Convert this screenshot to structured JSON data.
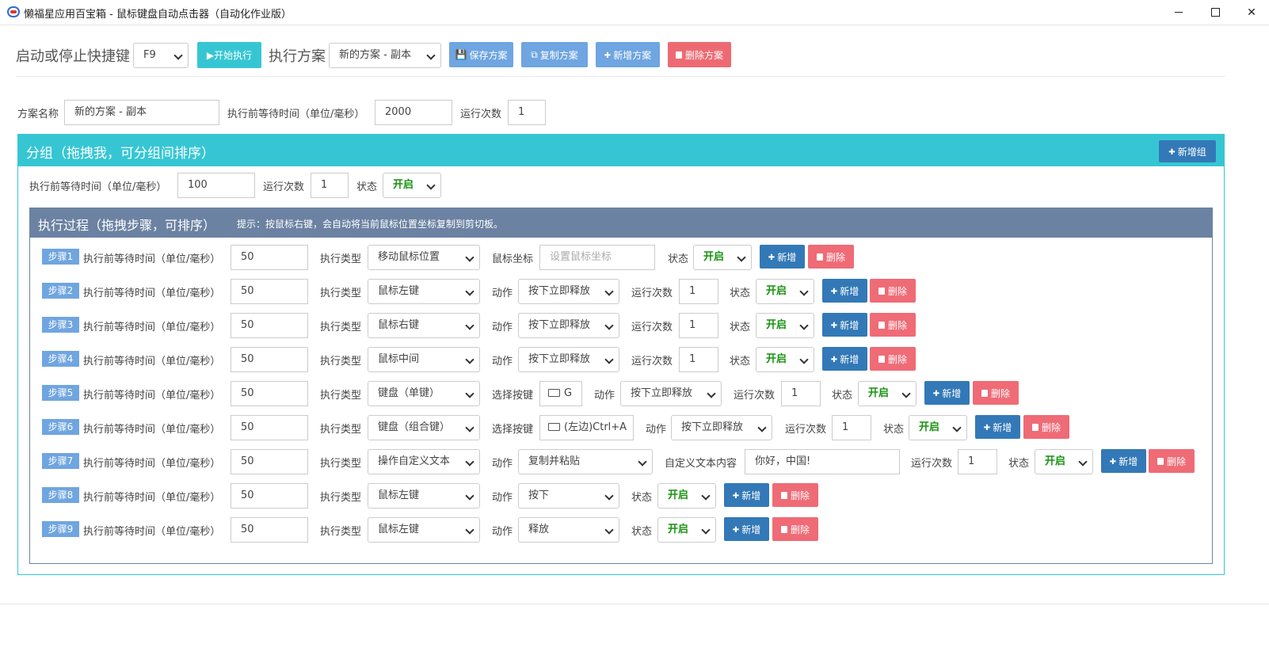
{
  "window": {
    "title": "懒福星应用百宝箱 - 鼠标键盘自动点击器（自动化作业版）"
  },
  "toolbar": {
    "hotkey_label": "启动或停止快捷键",
    "hotkey_value": "F9",
    "start_label": "▶开始执行",
    "plan_label": "执行方案",
    "plan_value": "新的方案 - 副本",
    "save_label": "保存方案",
    "copy_label": "复制方案",
    "add_label": "新增方案",
    "delete_label": "删除方案"
  },
  "plan": {
    "name_label": "方案名称",
    "name_value": "新的方案 - 副本",
    "wait_label": "执行前等待时间（单位/毫秒）",
    "wait_value": "2000",
    "runs_label": "运行次数",
    "runs_value": "1"
  },
  "group": {
    "title": "分组（拖拽我，可分组间排序）",
    "add_group_label": "新增组",
    "wait_label": "执行前等待时间（单位/毫秒）",
    "wait_value": "100",
    "runs_label": "运行次数",
    "runs_value": "1",
    "status_label": "状态",
    "status_value": "开启"
  },
  "process": {
    "title": "执行过程（拖拽步骤，可排序）",
    "hint": "提示：按鼠标右键，会自动将当前鼠标位置坐标复制到剪切板。"
  },
  "labels": {
    "wait": "执行前等待时间（单位/毫秒）",
    "type": "执行类型",
    "coord": "鼠标坐标",
    "action": "动作",
    "runs": "运行次数",
    "status": "状态",
    "key": "选择按键",
    "custom_text": "自定义文本内容",
    "add": "新增",
    "delete": "删除"
  },
  "steps": [
    {
      "badge": "步骤1",
      "wait": "50",
      "type": "移动鼠标位置",
      "coord_placeholder": "设置鼠标坐标",
      "status": "开启"
    },
    {
      "badge": "步骤2",
      "wait": "50",
      "type": "鼠标左键",
      "action": "按下立即释放",
      "runs": "1",
      "status": "开启"
    },
    {
      "badge": "步骤3",
      "wait": "50",
      "type": "鼠标右键",
      "action": "按下立即释放",
      "runs": "1",
      "status": "开启"
    },
    {
      "badge": "步骤4",
      "wait": "50",
      "type": "鼠标中间",
      "action": "按下立即释放",
      "runs": "1",
      "status": "开启"
    },
    {
      "badge": "步骤5",
      "wait": "50",
      "type": "键盘（单键）",
      "key": "G",
      "action": "按下立即释放",
      "runs": "1",
      "status": "开启"
    },
    {
      "badge": "步骤6",
      "wait": "50",
      "type": "键盘（组合键）",
      "key": "(左边)Ctrl+A",
      "action": "按下立即释放",
      "runs": "1",
      "status": "开启"
    },
    {
      "badge": "步骤7",
      "wait": "50",
      "type": "操作自定义文本",
      "action": "复制并粘贴",
      "custom_text": "你好，中国!",
      "runs": "1",
      "status": "开启"
    },
    {
      "badge": "步骤8",
      "wait": "50",
      "type": "鼠标左键",
      "action": "按下",
      "status": "开启"
    },
    {
      "badge": "步骤9",
      "wait": "50",
      "type": "鼠标左键",
      "action": "释放",
      "status": "开启"
    }
  ]
}
